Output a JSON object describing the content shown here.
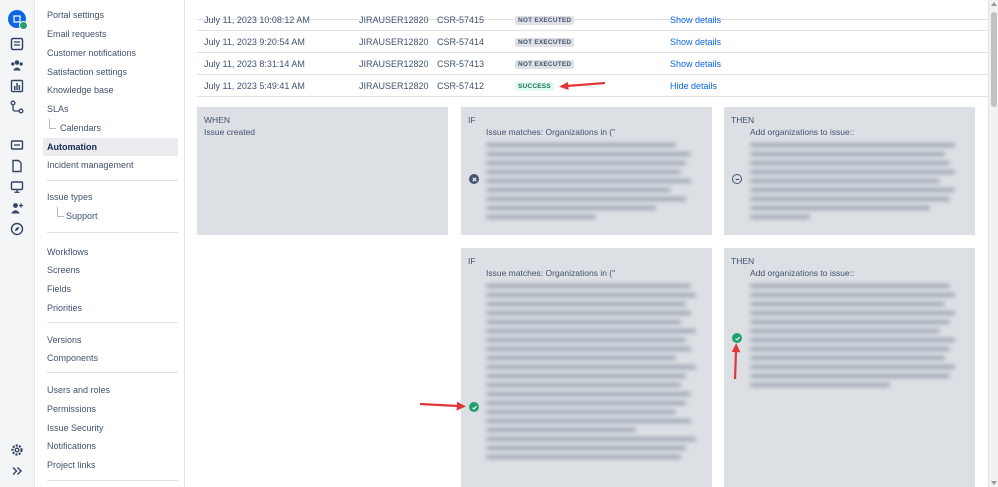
{
  "sidebar": {
    "items": [
      {
        "label": "Portal settings"
      },
      {
        "label": "Email requests"
      },
      {
        "label": "Customer notifications"
      },
      {
        "label": "Satisfaction settings"
      },
      {
        "label": "Knowledge base"
      },
      {
        "label": "SLAs"
      },
      {
        "label": "Calendars"
      },
      {
        "label": "Automation"
      },
      {
        "label": "Incident management"
      },
      {
        "label": "Issue types"
      },
      {
        "label": "Support"
      },
      {
        "label": "Workflows"
      },
      {
        "label": "Screens"
      },
      {
        "label": "Fields"
      },
      {
        "label": "Priorities"
      },
      {
        "label": "Versions"
      },
      {
        "label": "Components"
      },
      {
        "label": "Users and roles"
      },
      {
        "label": "Permissions"
      },
      {
        "label": "Issue Security"
      },
      {
        "label": "Notifications"
      },
      {
        "label": "Project links"
      }
    ]
  },
  "audit_log": {
    "rows": [
      {
        "date": "July 11, 2023 10:08:12 AM",
        "user": "JIRAUSER12820",
        "issue": "CSR-57415",
        "status": "NOT EXECUTED",
        "action": "Show details"
      },
      {
        "date": "July 11, 2023 9:20:54 AM",
        "user": "JIRAUSER12820",
        "issue": "CSR-57414",
        "status": "NOT EXECUTED",
        "action": "Show details"
      },
      {
        "date": "July 11, 2023 8:31:14 AM",
        "user": "JIRAUSER12820",
        "issue": "CSR-57413",
        "status": "NOT EXECUTED",
        "action": "Show details"
      },
      {
        "date": "July 11, 2023 5:49:41 AM",
        "user": "JIRAUSER12820",
        "issue": "CSR-57412",
        "status": "SUCCESS",
        "action": "Hide details"
      }
    ]
  },
  "rule_details": {
    "when": {
      "title": "WHEN",
      "trigger": "Issue created"
    },
    "branches": [
      {
        "if_title": "IF",
        "condition": "Issue matches: Organizations in (\"",
        "condition_state": "failed",
        "then_title": "THEN",
        "action": "Add organizations to issue::",
        "action_state": "skipped"
      },
      {
        "if_title": "IF",
        "condition": "Issue matches: Organizations in (\"",
        "condition_state": "passed",
        "then_title": "THEN",
        "action": "Add organizations to issue::",
        "action_state": "passed"
      }
    ]
  },
  "colors": {
    "accent": "#0c66e4",
    "success_badge_bg": "#dffcf0",
    "success_badge_text": "#216e4e",
    "success_icon": "#22a06b",
    "annotation_arrow": "#e0373b",
    "card_bg": "#dcdfe4"
  },
  "icons": {
    "rail": [
      "project-avatar-icon",
      "backlog-icon",
      "team-icon",
      "reports-icon",
      "workflow-icon",
      "inbox-icon",
      "page-icon",
      "monitor-icon",
      "add-user-icon",
      "compass-icon",
      "gear-icon",
      "expand-icon"
    ]
  }
}
